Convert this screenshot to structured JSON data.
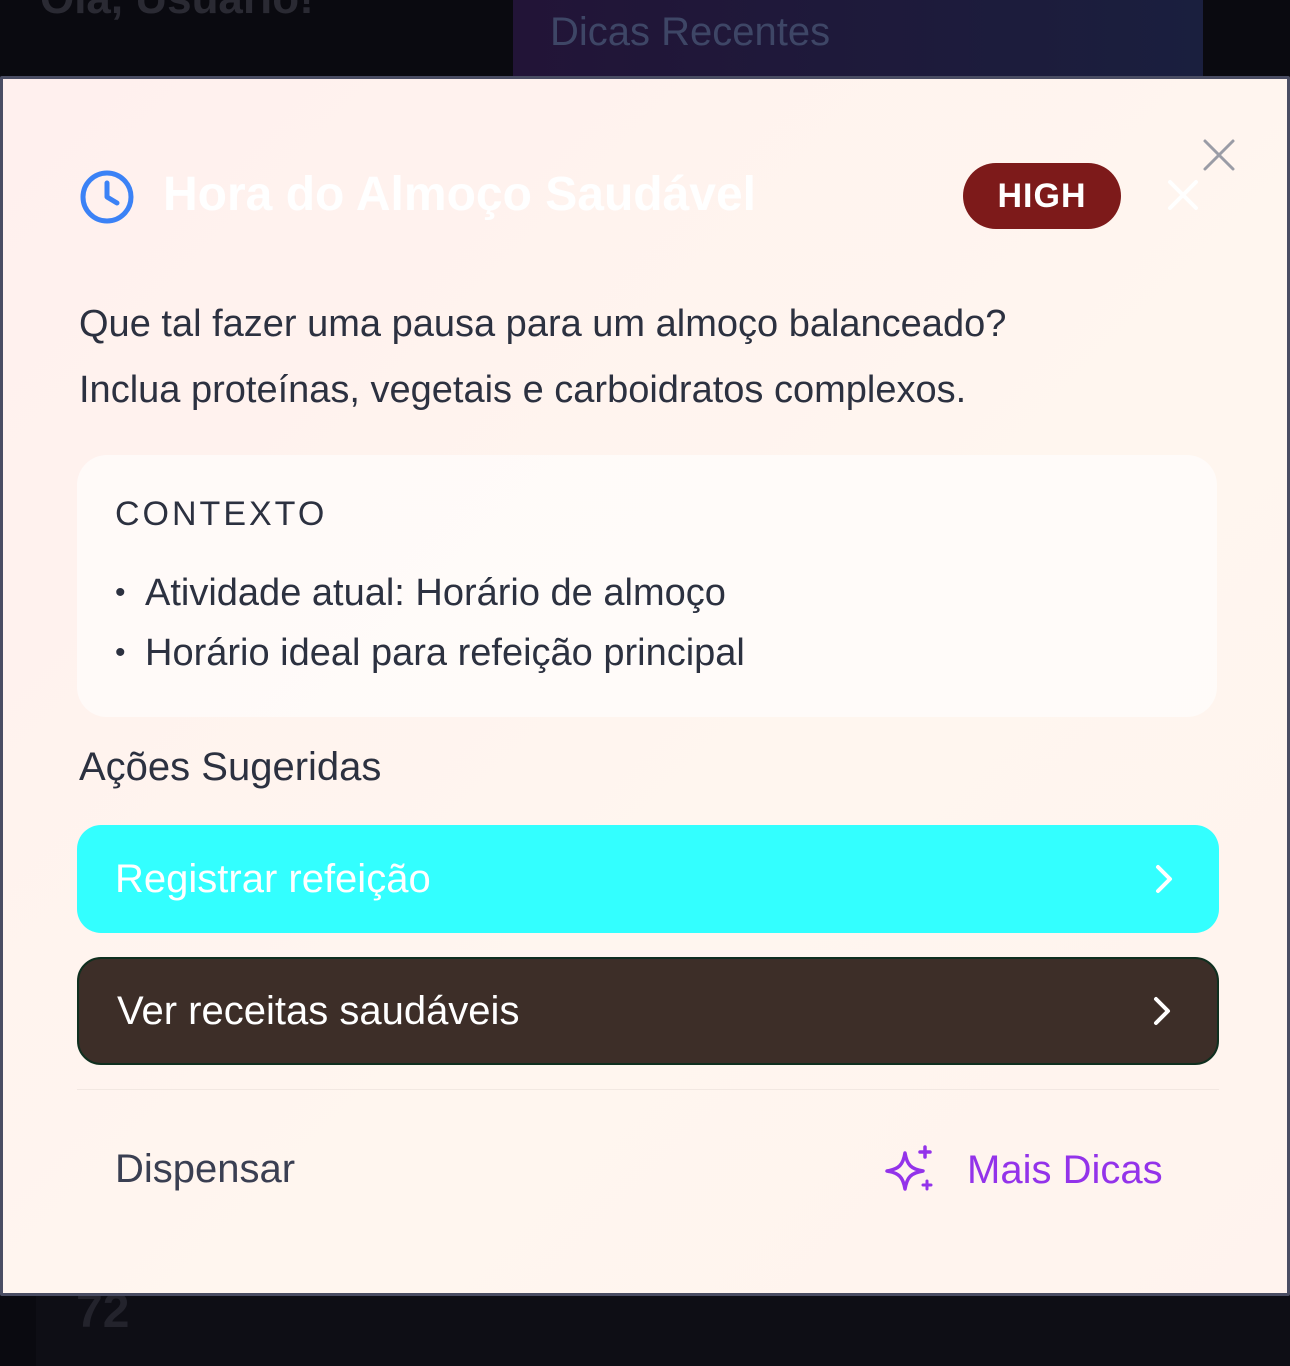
{
  "background": {
    "greeting": "Olá, Usuário!",
    "tips_title": "Dicas Recentes",
    "number": "72"
  },
  "modal": {
    "title": "Hora do Almoço Saudável",
    "priority": "HIGH",
    "message_line1": "Que tal fazer uma pausa para um almoço balanceado?",
    "message_line2": "Inclua proteínas, vegetais e carboidratos complexos.",
    "context": {
      "title": "CONTEXTO",
      "items": [
        "Atividade atual: Horário de almoço",
        "Horário ideal para refeição principal"
      ]
    },
    "actions_title": "Ações Sugeridas",
    "actions": [
      {
        "label": "Registrar refeição"
      },
      {
        "label": "Ver receitas saudáveis"
      }
    ],
    "dismiss_label": "Dispensar",
    "more_tips_label": "Mais Dicas"
  },
  "colors": {
    "accent_purple": "#9333ea",
    "clock_blue": "#3b82f6",
    "badge_red": "#7d1a1a",
    "primary_button": "#33ffff",
    "secondary_button": "#3d2e28"
  },
  "icons": {
    "clock": "clock-icon",
    "close": "close-icon",
    "chevron": "chevron-right-icon",
    "sparkle": "sparkle-icon"
  }
}
